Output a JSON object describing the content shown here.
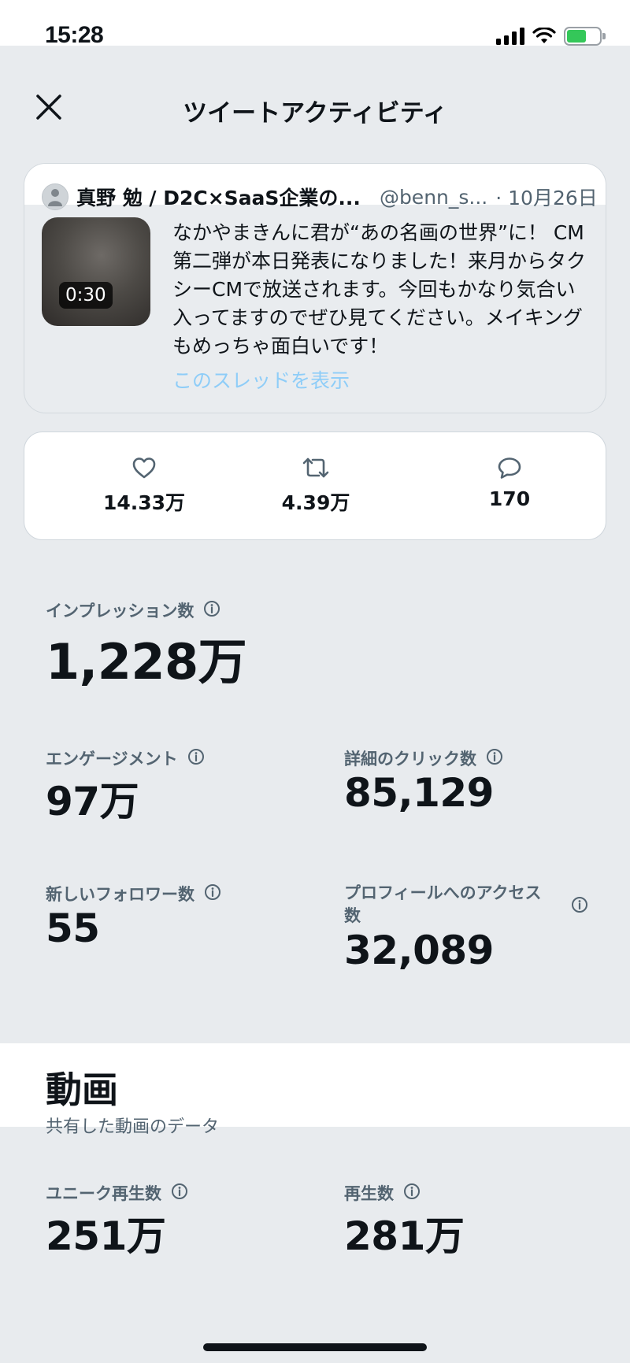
{
  "status_bar": {
    "time": "15:28"
  },
  "header": {
    "title": "ツイートアクティビティ"
  },
  "tweet": {
    "author_name": "真野 勉 / D2C×SaaS企業の...",
    "author_handle": "@benn_s...",
    "date": "· 10月26日",
    "video_duration": "0:30",
    "text": "なかやまきんに君が“あの名画の世界”に！ CM第二弾が本日発表になりました！来月からタクシーCMで放送されます。今回もかなり気合い入ってますのでぜひ見てください。メイキングもめっちゃ面白いです！",
    "thread_link": "このスレッドを表示"
  },
  "engagement_bar": {
    "likes": "14.33万",
    "retweets": "4.39万",
    "replies": "170"
  },
  "metrics": {
    "impressions_label": "インプレッション数",
    "impressions_value": "1,228万",
    "engagements_label": "エンゲージメント",
    "engagements_value": "97万",
    "detail_clicks_label": "詳細のクリック数",
    "detail_clicks_value": "85,129",
    "new_followers_label": "新しいフォロワー数",
    "new_followers_value": "55",
    "profile_visits_label": "プロフィールへのアクセス数",
    "profile_visits_value": "32,089"
  },
  "video": {
    "title": "動画",
    "subtitle": "共有した動画のデータ",
    "unique_views_label": "ユニーク再生数",
    "unique_views_value": "251万",
    "views_label": "再生数",
    "views_value": "281万"
  },
  "colors": {
    "background": "#e8ebee",
    "text_primary": "#0f1419",
    "text_secondary": "#536471",
    "link": "#8ecdf8",
    "battery": "#34c759"
  }
}
